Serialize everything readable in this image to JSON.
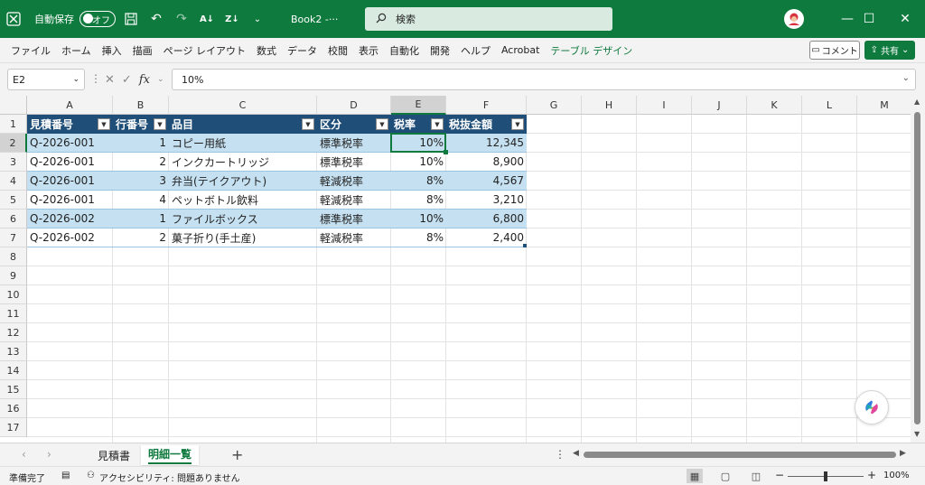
{
  "titlebar": {
    "autosave_label": "自動保存",
    "autosave_state": "オフ",
    "doc_title": "Book2  -···",
    "search_placeholder": "検索",
    "minimize": "—",
    "maximize": "☐",
    "close": "✕"
  },
  "menu": {
    "items": [
      "ファイル",
      "ホーム",
      "挿入",
      "描画",
      "ページ レイアウト",
      "数式",
      "データ",
      "校閲",
      "表示",
      "自動化",
      "開発",
      "ヘルプ",
      "Acrobat",
      "テーブル デザイン"
    ],
    "comment_label": "コメント",
    "share_label": "共有"
  },
  "formula_bar": {
    "name_box": "E2",
    "fx_label": "fx",
    "value": "10%"
  },
  "columns": [
    "A",
    "B",
    "C",
    "D",
    "E",
    "F",
    "G",
    "H",
    "I",
    "J",
    "K",
    "L",
    "M"
  ],
  "rows": [
    "1",
    "2",
    "3",
    "4",
    "5",
    "6",
    "7",
    "8",
    "9",
    "10",
    "11",
    "12",
    "13",
    "14",
    "15",
    "16",
    "17"
  ],
  "table": {
    "headers": [
      "見積番号",
      "行番号",
      "品目",
      "区分",
      "税率",
      "税抜金額"
    ],
    "rows": [
      [
        "Q-2026-001",
        "1",
        "コピー用紙",
        "標準税率",
        "10%",
        "12,345"
      ],
      [
        "Q-2026-001",
        "2",
        "インクカートリッジ",
        "標準税率",
        "10%",
        "8,900"
      ],
      [
        "Q-2026-001",
        "3",
        "弁当(テイクアウト)",
        "軽減税率",
        "8%",
        "4,567"
      ],
      [
        "Q-2026-001",
        "4",
        "ペットボトル飲料",
        "軽減税率",
        "8%",
        "3,210"
      ],
      [
        "Q-2026-002",
        "1",
        "ファイルボックス",
        "標準税率",
        "10%",
        "6,800"
      ],
      [
        "Q-2026-002",
        "2",
        "菓子折り(手土産)",
        "軽減税率",
        "8%",
        "2,400"
      ]
    ]
  },
  "sheets": {
    "tabs": [
      "見積書",
      "明細一覧"
    ],
    "active": "明細一覧",
    "add": "+"
  },
  "status": {
    "ready": "準備完了",
    "accessibility": "アクセシビリティ: 問題ありません",
    "zoom": "100%",
    "zoom_minus": "−",
    "zoom_plus": "+",
    "zoom_level": 1.0
  },
  "colors": {
    "brand": "#0f7a3e",
    "table_header": "#1f4e78",
    "table_band": "#c5e0f0"
  }
}
